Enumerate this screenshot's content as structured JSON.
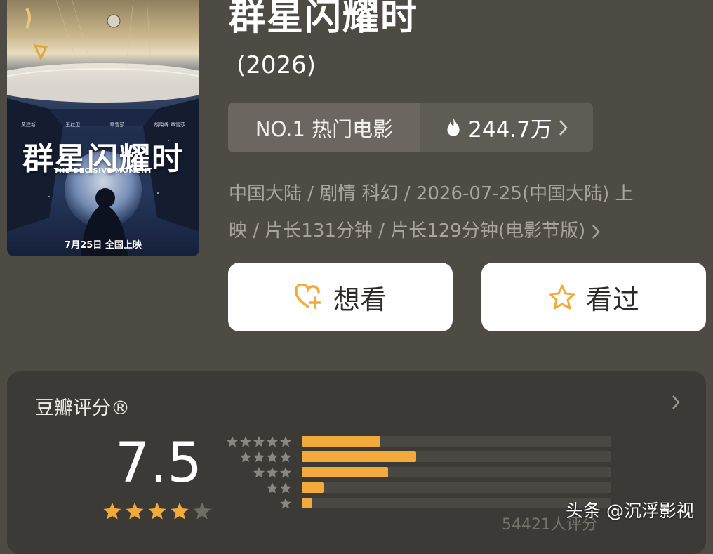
{
  "poster": {
    "title": "群星闪耀时",
    "subtitle": "THE DECISIVE MOMENT",
    "credits": [
      "黄建新",
      "王红卫",
      "章雪莎",
      "胡晓峰 章雪莎"
    ],
    "release": "7月25日 全国上映"
  },
  "movie": {
    "title": "群星闪耀时",
    "year": "(2026)",
    "rank_label": "NO.1 热门电影",
    "heat_value": "244.7万",
    "heat_icon": "fire-icon",
    "meta_line1": "中国大陆 / 剧情 科幻 / 2026-07-25(中国大陆) 上",
    "meta_line2": "映 / 片长131分钟 / 片长129分钟(电影节版)"
  },
  "actions": {
    "wish_label": "想看",
    "wish_icon": "heart-plus-icon",
    "seen_label": "看过",
    "seen_icon": "star-outline-icon"
  },
  "rating": {
    "label": "豆瓣评分®",
    "score": "7.5",
    "stars_filled": 4,
    "stars_total": 5,
    "votes": "54421人评分",
    "distribution": [
      {
        "stars": 5,
        "fraction": 0.255
      },
      {
        "stars": 4,
        "fraction": 0.37
      },
      {
        "stars": 3,
        "fraction": 0.28
      },
      {
        "stars": 2,
        "fraction": 0.07
      },
      {
        "stars": 1,
        "fraction": 0.035
      }
    ],
    "accent": "#f2ab3b"
  },
  "watermark": "头条 @沉浮影视"
}
